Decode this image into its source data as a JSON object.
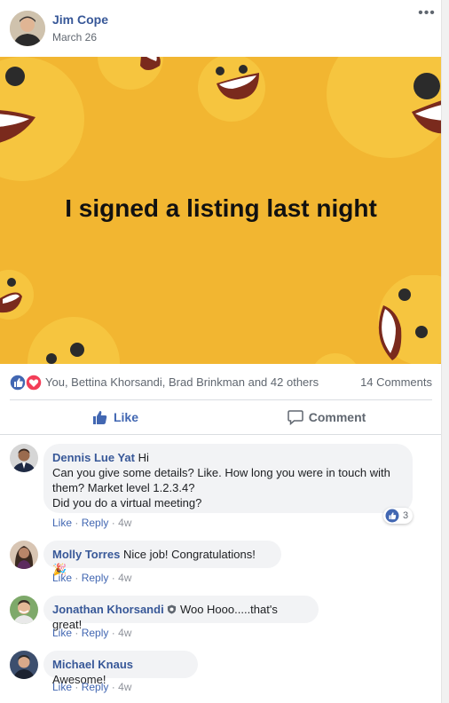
{
  "post": {
    "author": "Jim Cope",
    "date": "March 26",
    "banner_text": "I signed a listing last night",
    "reaction_summary": "You, Bettina Khorsandi, Brad Brinkman and 42 others",
    "comment_count": "14 Comments",
    "like_label": "Like",
    "comment_label": "Comment"
  },
  "comments": [
    {
      "name": "Dennis Lue Yat",
      "lines": [
        "Hi",
        "Can you give some details? Like. How long you were in touch with",
        "them? Market level 1.2.3.4?",
        "Did you do a virtual meeting?"
      ],
      "like": "Like",
      "reply": "Reply",
      "time": "4w",
      "reactions": "3"
    },
    {
      "name": "Molly Torres",
      "text": "Nice job! Congratulations! 🎉",
      "like": "Like",
      "reply": "Reply",
      "time": "4w"
    },
    {
      "name": "Jonathan Khorsandi",
      "text": "Woo Hooo.....that's great!",
      "like": "Like",
      "reply": "Reply",
      "time": "4w"
    },
    {
      "name": "Michael Knaus",
      "text": "Awesome!",
      "like": "Like",
      "reply": "Reply",
      "time": "4w"
    }
  ],
  "meta_separator": "·",
  "icons": {
    "more": "more-options-icon",
    "like": "thumbs-up-icon",
    "love": "heart-icon",
    "comment": "comment-bubble-icon",
    "badge": "shield-badge-icon"
  },
  "colors": {
    "link": "#385898",
    "accent": "#4267b2",
    "banner": "#f2b631",
    "love": "#f33e58"
  }
}
